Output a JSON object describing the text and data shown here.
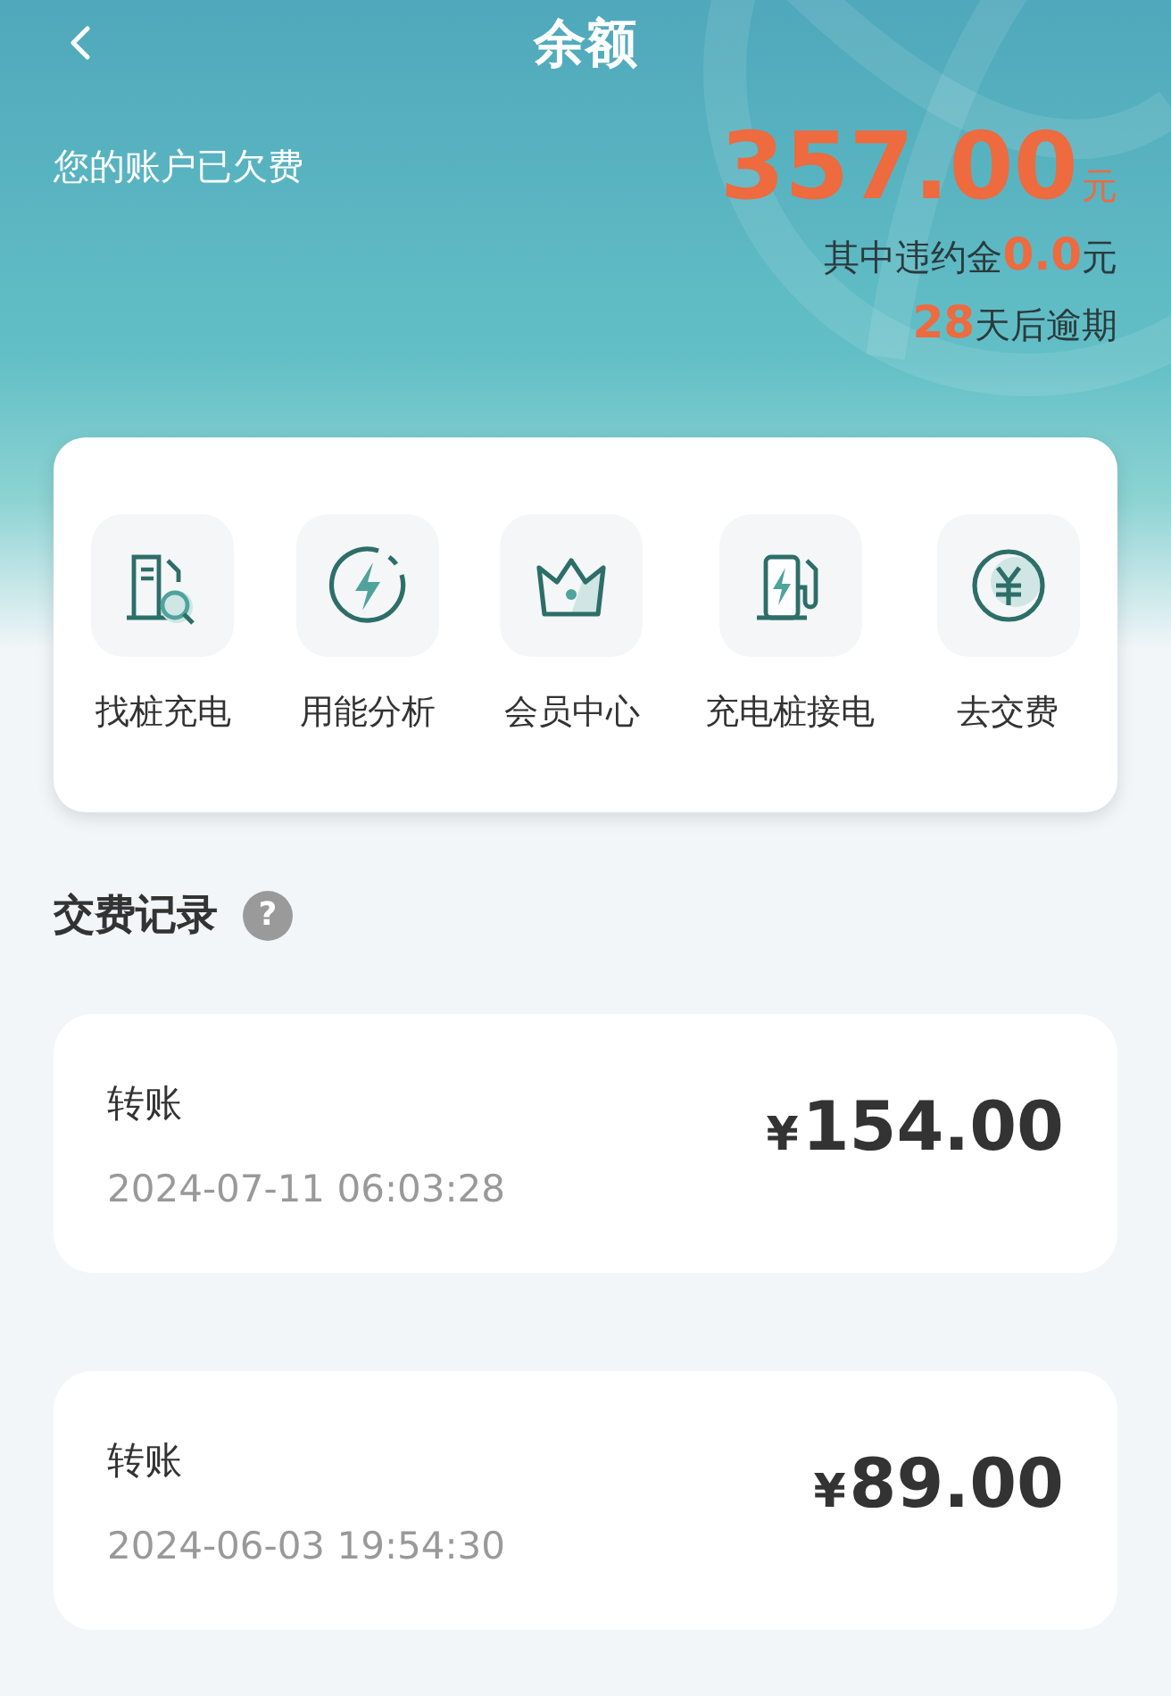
{
  "header": {
    "title": "余额"
  },
  "status": {
    "message": "您的账户已欠费",
    "amount": "357.00",
    "unit": "元"
  },
  "penalty": {
    "label": "其中违约金",
    "amount": "0.0",
    "unit": "元"
  },
  "due": {
    "days": "28",
    "suffix": "天后逾期"
  },
  "services": [
    {
      "kind": "station-search",
      "label": "找桩充电"
    },
    {
      "kind": "energy",
      "label": "用能分析"
    },
    {
      "kind": "crown",
      "label": "会员中心"
    },
    {
      "kind": "charger",
      "label": "充电桩接电"
    },
    {
      "kind": "yuan",
      "label": "去交费"
    }
  ],
  "records_section": {
    "title": "交费记录",
    "help": "?"
  },
  "records": [
    {
      "type": "转账",
      "currency": "¥",
      "amount": "154.00",
      "time": "2024-07-11 06:03:28"
    },
    {
      "type": "转账",
      "currency": "¥",
      "amount": "89.00",
      "time": "2024-06-03 19:54:30"
    }
  ]
}
